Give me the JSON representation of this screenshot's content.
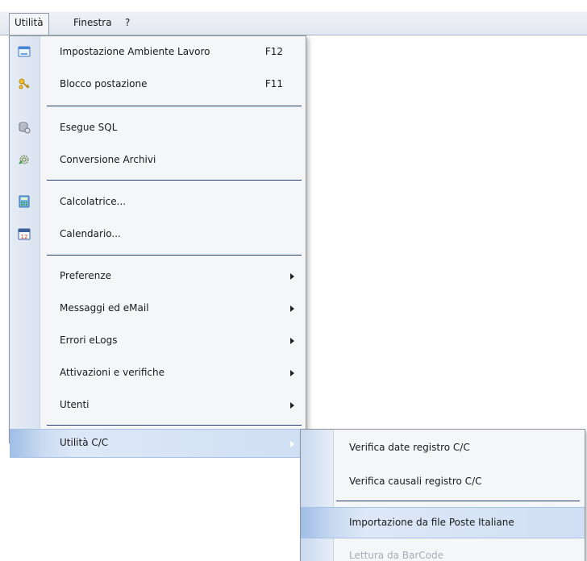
{
  "menubar": {
    "items": [
      "Utilità",
      "Finestra",
      "?"
    ]
  },
  "menu": {
    "items": [
      {
        "label": "Impostazione Ambiente Lavoro",
        "shortcut": "F12",
        "icon": "settings-window-icon"
      },
      {
        "label": "Blocco postazione",
        "shortcut": "F11",
        "icon": "keys-icon"
      },
      {
        "label": "Esegue SQL",
        "icon": "database-icon"
      },
      {
        "label": "Conversione Archivi",
        "icon": "gears-icon"
      },
      {
        "label": "Calcolatrice...",
        "icon": "calculator-icon"
      },
      {
        "label": "Calendario...",
        "icon": "calendar-icon",
        "icon_text": "12"
      },
      {
        "label": "Preferenze",
        "submenu": true
      },
      {
        "label": "Messaggi ed eMail",
        "submenu": true
      },
      {
        "label": "Errori eLogs",
        "submenu": true
      },
      {
        "label": "Attivazioni e verifiche",
        "submenu": true
      },
      {
        "label": "Utenti",
        "submenu": true
      },
      {
        "label": "Utilità C/C",
        "submenu": true,
        "highlighted": true
      }
    ]
  },
  "submenu": {
    "items": [
      {
        "label": "Verifica date registro C/C"
      },
      {
        "label": "Verifica causali registro C/C"
      },
      {
        "label": "Importazione da file Poste Italiane",
        "highlighted": true
      },
      {
        "label": "Lettura da BarCode",
        "disabled": true
      }
    ]
  },
  "colors": {
    "highlight": "#c9daf1",
    "separator": "#233a6a",
    "menu_bg": "#f5f6f8",
    "gutter": "#dde5f0"
  }
}
